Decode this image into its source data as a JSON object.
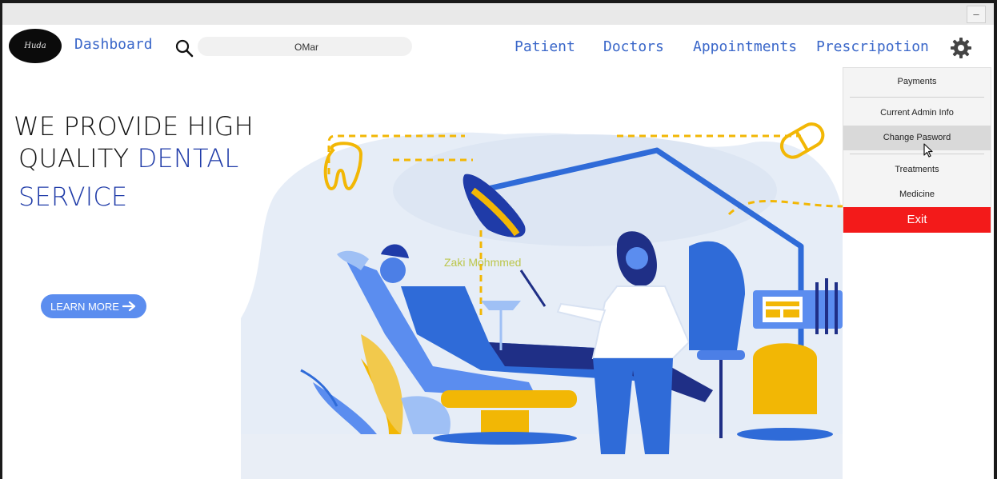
{
  "window": {
    "minimize_label": "–"
  },
  "nav": {
    "logo_text": "Huda",
    "dashboard": "Dashboard",
    "patient": "Patient",
    "doctors": "Doctors",
    "appointments": "Appointments",
    "prescription": "Prescripotion"
  },
  "search": {
    "value": "OMar"
  },
  "hero": {
    "line1": "WE PROVIDE HIGH",
    "line2a": "QUALITY ",
    "line2b": "DENTAL",
    "line3": "SERVICE",
    "button": "LEARN MORE"
  },
  "illustration": {
    "watermark": "Zaki Mohmmed"
  },
  "settings_menu": {
    "payments": "Payments",
    "admin_info": "Current Admin Info",
    "change_password": "Change Pasword",
    "treatments": "Treatments",
    "medicine": "Medicine",
    "exit": "Exit"
  },
  "colors": {
    "accent": "#3a67c9",
    "exit": "#f31a1a",
    "button": "#5b8def"
  }
}
